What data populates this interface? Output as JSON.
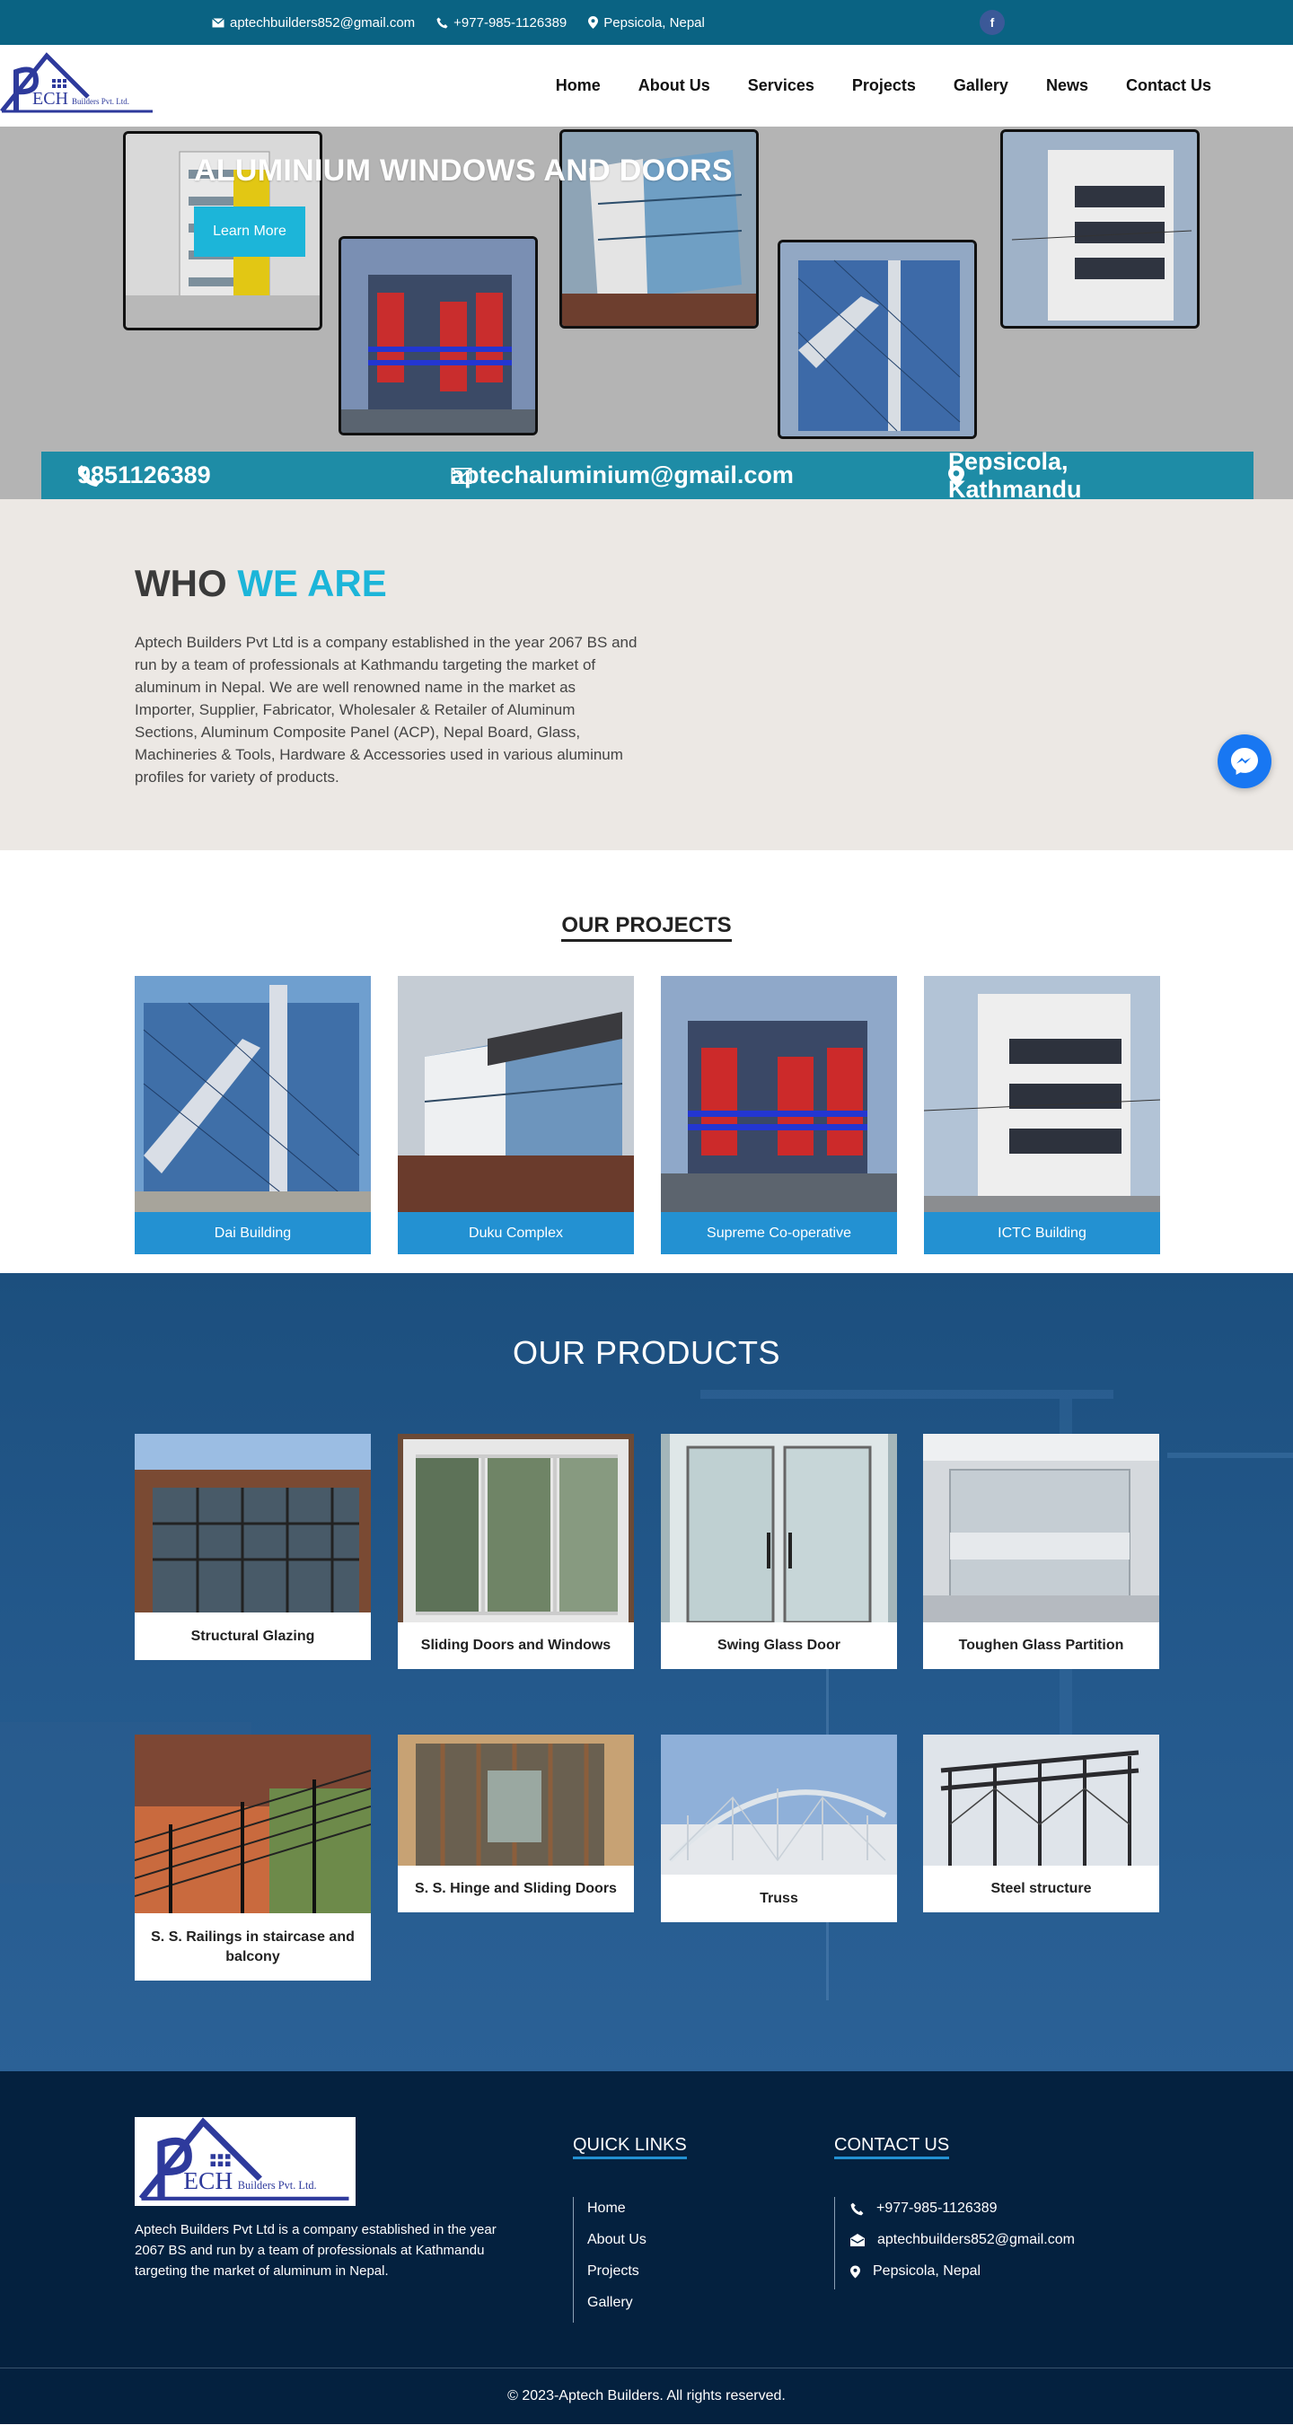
{
  "topbar": {
    "email": "aptechbuilders852@gmail.com",
    "phone": "+977-985-1126389",
    "location": "Pepsicola, Nepal",
    "social_icon": "facebook-icon"
  },
  "logo": {
    "mark": "ECH",
    "company": "Builders Pvt. Ltd."
  },
  "nav": {
    "items": [
      "Home",
      "About Us",
      "Services",
      "Projects",
      "Gallery",
      "News",
      "Contact Us"
    ]
  },
  "hero": {
    "title": "ALUMINIUM WINDOWS AND DOORS",
    "button": "Learn More",
    "strip_phone": "9851126389",
    "strip_email": "aptechaluminium@gmail.com",
    "strip_location": "Pepsicola, Kathmandu"
  },
  "who": {
    "heading_plain": "WHO",
    "heading_accent": "WE ARE",
    "text": "Aptech Builders Pvt Ltd is a company established in the year 2067 BS and run by a team of professionals at Kathmandu targeting the market of aluminum in Nepal. We are well renowned name in the market as Importer, Supplier, Fabricator, Wholesaler & Retailer of Aluminum Sections, Aluminum Composite Panel (ACP), Nepal Board, Glass, Machineries & Tools, Hardware & Accessories used in various aluminum profiles for variety of products."
  },
  "projects": {
    "title": "OUR PROJECTS",
    "items": [
      "Dai Building",
      "Duku Complex",
      "Supreme Co-operative",
      "ICTC Building"
    ]
  },
  "products": {
    "title": "OUR PRODUCTS",
    "items": [
      "Structural Glazing",
      "Sliding Doors and Windows",
      "Swing Glass Door",
      "Toughen Glass Partition",
      "S. S. Railings in staircase and balcony",
      "S. S. Hinge and Sliding Doors",
      "Truss",
      "Steel structure"
    ]
  },
  "footer": {
    "description": "Aptech Builders Pvt Ltd is a company established in the year 2067 BS and run by a team of professionals at Kathmandu targeting the market of aluminum in Nepal.",
    "quick_links_title": "QUICK LINKS",
    "quick_links": [
      "Home",
      "About Us",
      "Projects",
      "Gallery"
    ],
    "contact_title": "CONTACT US",
    "phone": "+977-985-1126389",
    "email": "aptechbuilders852@gmail.com",
    "location": "Pepsicola, Nepal",
    "copyright": "© 2023-Aptech Builders. All rights reserved."
  },
  "colors": {
    "topbar": "#0a6383",
    "accent": "#1cb5d9",
    "project_caption": "#2391d2",
    "footer": "#04213f"
  }
}
